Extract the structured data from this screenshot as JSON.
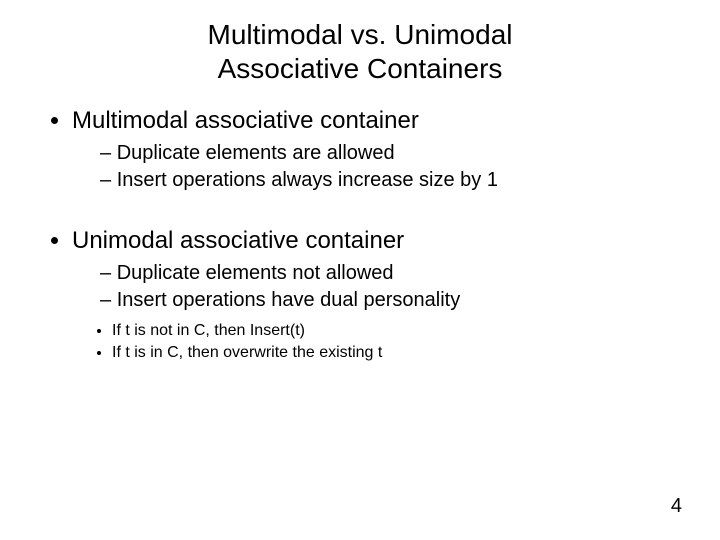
{
  "title_line1": "Multimodal vs. Unimodal",
  "title_line2": "Associative Containers",
  "sections": [
    {
      "heading": "Multimodal associative container",
      "subitems": [
        "Duplicate elements are allowed",
        "Insert operations always increase size by 1"
      ],
      "subsubitems": []
    },
    {
      "heading": "Unimodal associative container",
      "subitems": [
        "Duplicate elements not allowed",
        "Insert operations have dual personality"
      ],
      "subsubitems": [
        "If t is not in C, then Insert(t)",
        "If t is in C, then overwrite the existing t"
      ]
    }
  ],
  "page_number": "4"
}
